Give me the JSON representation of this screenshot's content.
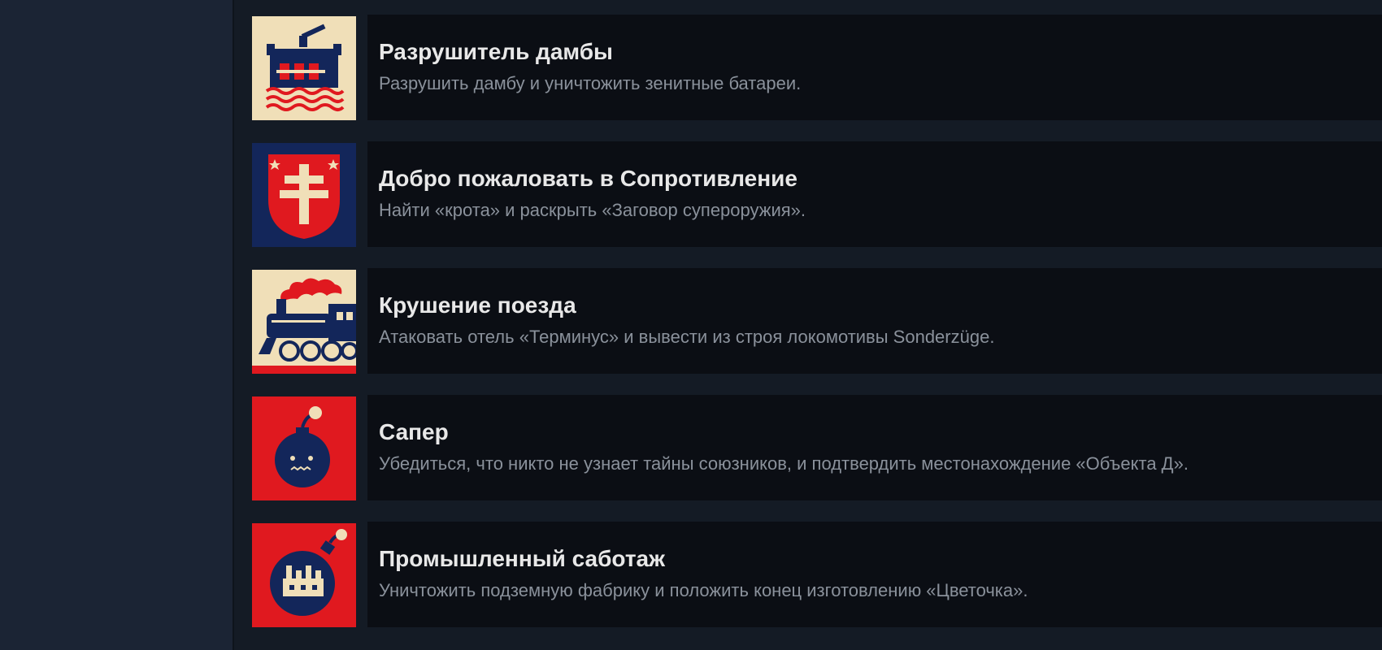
{
  "achievements": [
    {
      "title": "Разрушитель дамбы",
      "description": "Разрушить дамбу и уничтожить зенитные батареи.",
      "icon": "dam-icon"
    },
    {
      "title": "Добро пожаловать в Сопротивление",
      "description": "Найти «крота» и раскрыть «Заговор супероружия».",
      "icon": "cross-shield-icon"
    },
    {
      "title": "Крушение поезда",
      "description": "Атаковать отель «Терминус» и вывести из строя локомотивы Sonderzüge.",
      "icon": "locomotive-icon"
    },
    {
      "title": "Сапер",
      "description": "Убедиться, что никто не узнает тайны союзников, и подтвердить местонахождение «Объекта Д».",
      "icon": "bomb-icon"
    },
    {
      "title": "Промышленный саботаж",
      "description": "Уничтожить подземную фабрику и положить конец изготовлению «Цветочка».",
      "icon": "factory-bomb-icon"
    }
  ],
  "colors": {
    "cream": "#f0dfb8",
    "navy": "#13265a",
    "red": "#e0191f"
  }
}
